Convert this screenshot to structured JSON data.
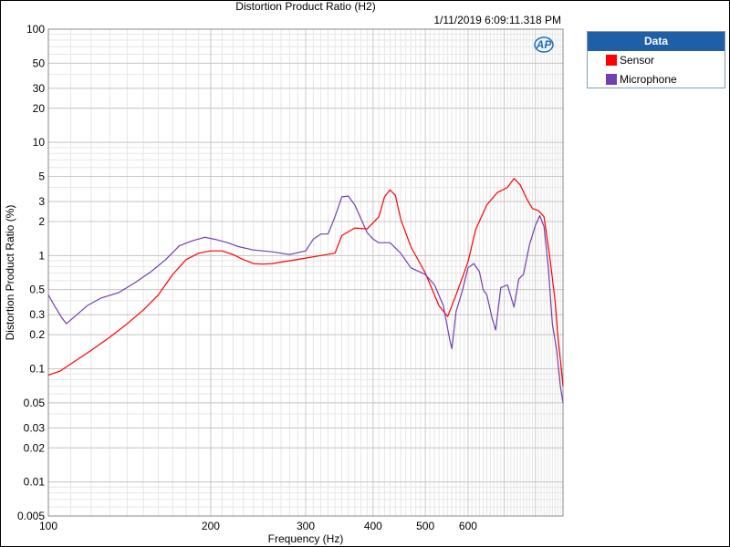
{
  "window": {
    "timestamp": "1/11/2019 6:09:11.318 PM",
    "logo_text": "AP"
  },
  "legend": {
    "header": "Data",
    "header_color": "#1e5fa8",
    "items": [
      {
        "label": "Sensor",
        "color": "#ff0000"
      },
      {
        "label": "Microphone",
        "color": "#7040b0"
      }
    ]
  },
  "chart_data": {
    "type": "line",
    "title": "Distortion Product Ratio (H2)",
    "xlabel": "Frequency (Hz)",
    "ylabel": "Distortion Product Ratio (%)",
    "x_scale": "log",
    "y_scale": "log",
    "xlim": [
      100,
      900
    ],
    "ylim": [
      0.005,
      100
    ],
    "grid": true,
    "legend_position": "right",
    "x_ticks": [
      100,
      200,
      300,
      400,
      500,
      600
    ],
    "x_tick_labels": [
      "100",
      "200",
      "300",
      "400",
      "500",
      "600"
    ],
    "y_ticks": [
      0.005,
      0.01,
      0.02,
      0.03,
      0.05,
      0.1,
      0.2,
      0.3,
      0.5,
      1,
      2,
      3,
      5,
      10,
      20,
      30,
      50,
      100
    ],
    "y_tick_labels": [
      "0.005",
      "0.01",
      "0.02",
      "0.03",
      "0.05",
      "0.1",
      "0.2",
      "0.3",
      "0.5",
      "1",
      "2",
      "3",
      "5",
      "10",
      "20",
      "30",
      "50",
      "100"
    ],
    "series": [
      {
        "name": "Sensor",
        "color": "#ff0000",
        "points": [
          [
            100,
            0.088
          ],
          [
            105,
            0.095
          ],
          [
            110,
            0.11
          ],
          [
            120,
            0.145
          ],
          [
            130,
            0.19
          ],
          [
            140,
            0.25
          ],
          [
            150,
            0.33
          ],
          [
            160,
            0.45
          ],
          [
            170,
            0.68
          ],
          [
            180,
            0.92
          ],
          [
            190,
            1.05
          ],
          [
            200,
            1.1
          ],
          [
            210,
            1.1
          ],
          [
            220,
            1.02
          ],
          [
            230,
            0.92
          ],
          [
            240,
            0.85
          ],
          [
            250,
            0.84
          ],
          [
            260,
            0.85
          ],
          [
            280,
            0.9
          ],
          [
            300,
            0.95
          ],
          [
            320,
            1.0
          ],
          [
            340,
            1.05
          ],
          [
            350,
            1.5
          ],
          [
            370,
            1.75
          ],
          [
            390,
            1.72
          ],
          [
            410,
            2.2
          ],
          [
            420,
            3.3
          ],
          [
            430,
            3.8
          ],
          [
            440,
            3.4
          ],
          [
            450,
            2.1
          ],
          [
            470,
            1.2
          ],
          [
            500,
            0.7
          ],
          [
            530,
            0.36
          ],
          [
            550,
            0.29
          ],
          [
            570,
            0.45
          ],
          [
            600,
            0.88
          ],
          [
            620,
            1.7
          ],
          [
            650,
            2.8
          ],
          [
            680,
            3.6
          ],
          [
            710,
            4.0
          ],
          [
            730,
            4.8
          ],
          [
            750,
            4.2
          ],
          [
            770,
            3.2
          ],
          [
            790,
            2.6
          ],
          [
            810,
            2.5
          ],
          [
            830,
            2.2
          ],
          [
            850,
            1.0
          ],
          [
            870,
            0.4
          ],
          [
            880,
            0.2
          ],
          [
            890,
            0.12
          ],
          [
            900,
            0.07
          ]
        ]
      },
      {
        "name": "Microphone",
        "color": "#7040b0",
        "points": [
          [
            100,
            0.45
          ],
          [
            103,
            0.35
          ],
          [
            106,
            0.28
          ],
          [
            108,
            0.25
          ],
          [
            112,
            0.29
          ],
          [
            118,
            0.36
          ],
          [
            125,
            0.42
          ],
          [
            135,
            0.47
          ],
          [
            145,
            0.58
          ],
          [
            155,
            0.72
          ],
          [
            165,
            0.92
          ],
          [
            175,
            1.22
          ],
          [
            185,
            1.35
          ],
          [
            195,
            1.45
          ],
          [
            205,
            1.38
          ],
          [
            215,
            1.3
          ],
          [
            225,
            1.2
          ],
          [
            240,
            1.12
          ],
          [
            260,
            1.08
          ],
          [
            280,
            1.02
          ],
          [
            300,
            1.1
          ],
          [
            310,
            1.4
          ],
          [
            320,
            1.55
          ],
          [
            330,
            1.55
          ],
          [
            340,
            2.2
          ],
          [
            350,
            3.3
          ],
          [
            360,
            3.35
          ],
          [
            370,
            2.8
          ],
          [
            380,
            2.1
          ],
          [
            390,
            1.6
          ],
          [
            400,
            1.4
          ],
          [
            410,
            1.3
          ],
          [
            420,
            1.3
          ],
          [
            430,
            1.3
          ],
          [
            450,
            1.05
          ],
          [
            470,
            0.78
          ],
          [
            500,
            0.68
          ],
          [
            520,
            0.55
          ],
          [
            540,
            0.36
          ],
          [
            555,
            0.18
          ],
          [
            560,
            0.15
          ],
          [
            570,
            0.32
          ],
          [
            585,
            0.48
          ],
          [
            600,
            0.78
          ],
          [
            615,
            0.85
          ],
          [
            630,
            0.72
          ],
          [
            640,
            0.5
          ],
          [
            650,
            0.45
          ],
          [
            665,
            0.28
          ],
          [
            675,
            0.22
          ],
          [
            690,
            0.52
          ],
          [
            710,
            0.55
          ],
          [
            730,
            0.35
          ],
          [
            745,
            0.62
          ],
          [
            760,
            0.68
          ],
          [
            780,
            1.25
          ],
          [
            800,
            1.85
          ],
          [
            815,
            2.25
          ],
          [
            830,
            1.8
          ],
          [
            845,
            0.8
          ],
          [
            860,
            0.25
          ],
          [
            875,
            0.15
          ],
          [
            890,
            0.07
          ],
          [
            900,
            0.05
          ]
        ]
      }
    ]
  }
}
